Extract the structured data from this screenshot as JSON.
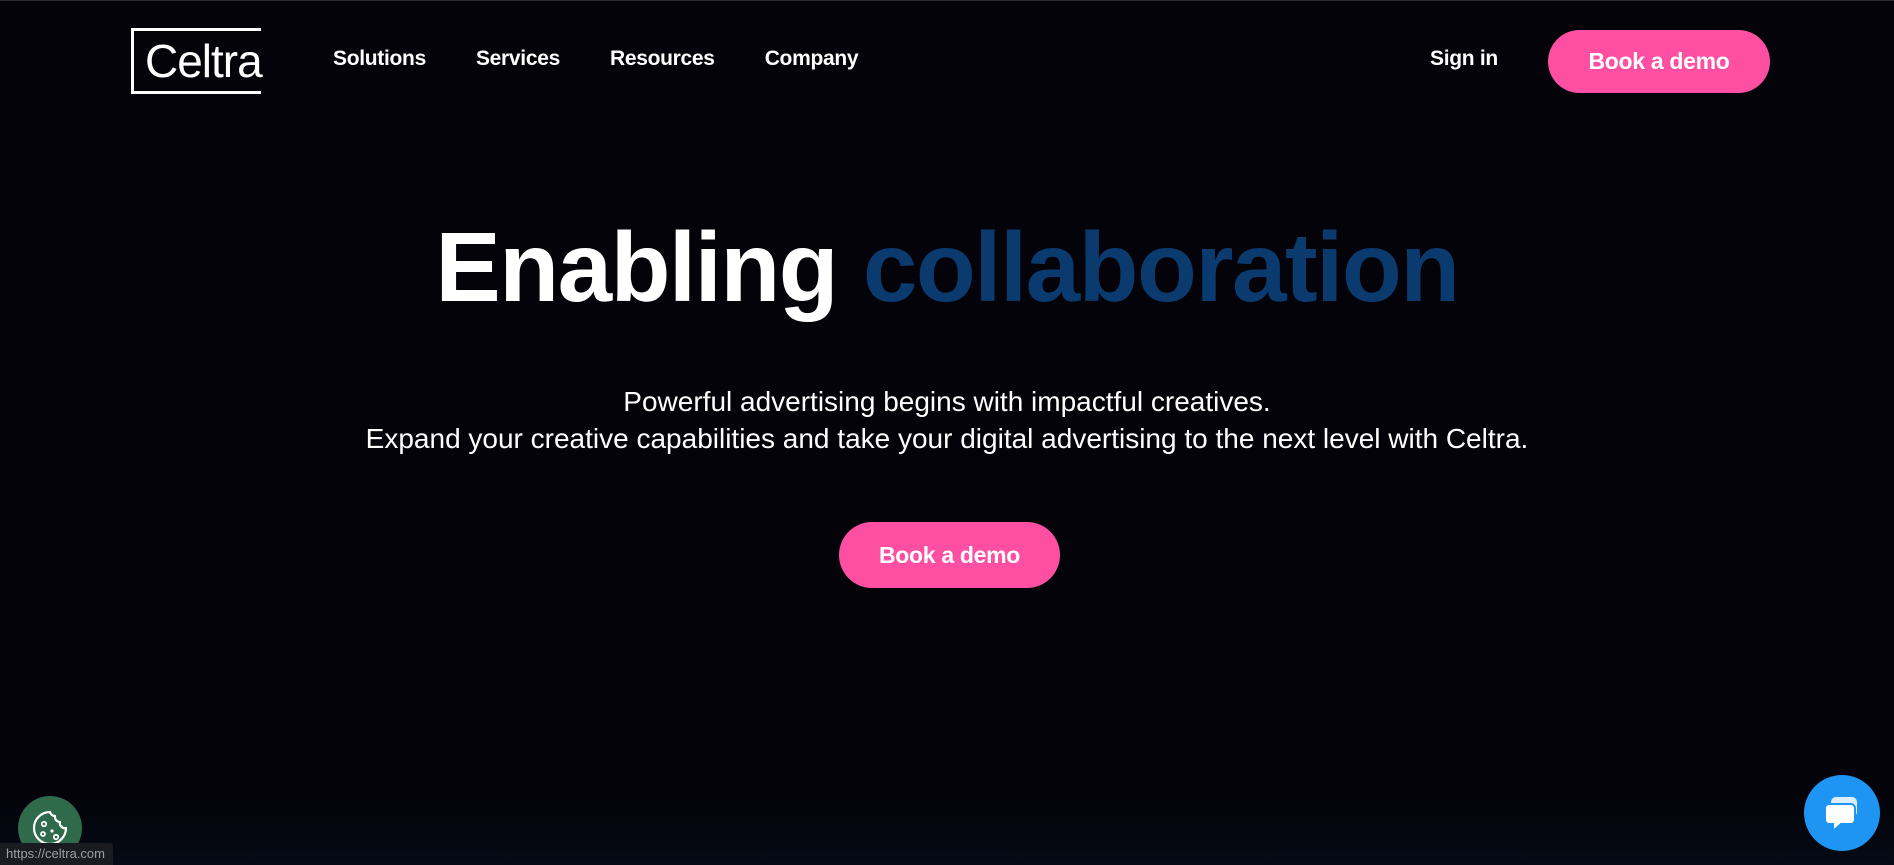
{
  "header": {
    "logo_text": "Celtra",
    "nav": [
      {
        "label": "Solutions"
      },
      {
        "label": "Services"
      },
      {
        "label": "Resources"
      },
      {
        "label": "Company"
      }
    ],
    "sign_in_label": "Sign in",
    "demo_button_label": "Book a demo"
  },
  "hero": {
    "title_part1": "Enabling",
    "title_part2": "collaboration",
    "subtitle_line1": "Powerful advertising begins with impactful creatives.",
    "subtitle_line2": "Expand your creative capabilities and take your digital advertising to the next level with Celtra.",
    "cta_label": "Book a demo"
  },
  "status_bar": {
    "url": "https://celtra.com"
  },
  "widgets": {
    "cookie_icon": "cookie-icon",
    "chat_icon": "chat-bubble-icon"
  },
  "colors": {
    "background": "#04030a",
    "accent_pink": "#ff4fa3",
    "title_blue": "#0a3a6e",
    "cookie_green": "#2f6a4a",
    "chat_blue": "#1e95f3"
  }
}
